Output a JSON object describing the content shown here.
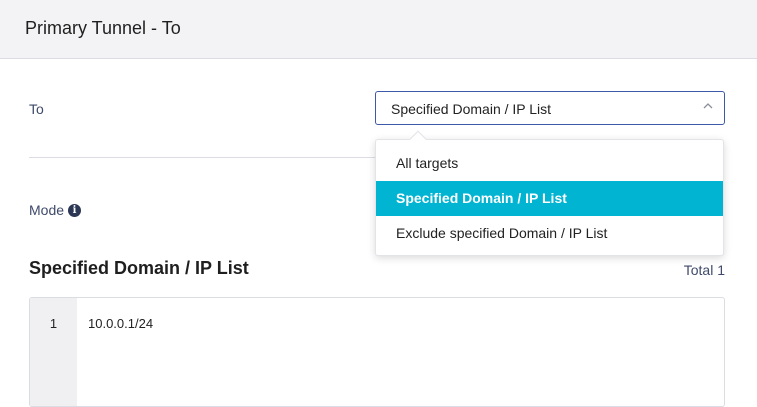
{
  "header": {
    "title": "Primary Tunnel - To"
  },
  "form": {
    "to_label": "To",
    "mode_label": "Mode",
    "mode_info_icon": "info-icon",
    "select": {
      "value": "Specified Domain / IP List",
      "caret_icon": "chevron-up-icon",
      "open": true
    }
  },
  "dropdown": {
    "options": [
      {
        "label": "All targets",
        "selected": false
      },
      {
        "label": "Specified Domain / IP List",
        "selected": true
      },
      {
        "label": "Exclude specified Domain / IP List",
        "selected": false
      }
    ]
  },
  "list": {
    "title": "Specified Domain / IP List",
    "total": "Total 1",
    "entries": [
      {
        "line": "1",
        "value": "10.0.0.1/24"
      }
    ]
  },
  "colors": {
    "selected_bg": "#00b4d2",
    "header_bg": "#f3f3f5",
    "select_border": "#3d5aa8"
  }
}
